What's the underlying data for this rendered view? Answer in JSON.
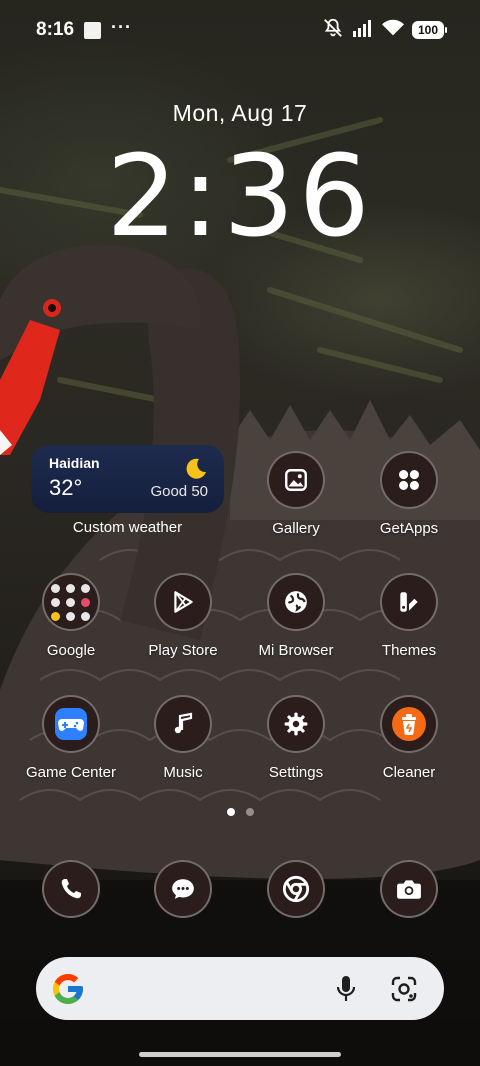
{
  "status_bar": {
    "time": "8:16",
    "more": "···",
    "battery": "100"
  },
  "lock_clock": {
    "date": "Mon, Aug 17",
    "time": "2:36"
  },
  "weather_widget": {
    "city": "Haidian",
    "temperature": "32°",
    "air_quality": "Good 50",
    "label": "Custom weather"
  },
  "apps": {
    "gallery": "Gallery",
    "getapps": "GetApps",
    "google": "Google",
    "play_store": "Play Store",
    "mi_browser": "Mi Browser",
    "themes": "Themes",
    "game_center": "Game Center",
    "music": "Music",
    "settings": "Settings",
    "cleaner": "Cleaner"
  },
  "dock": {
    "phone_icon": "phone-icon",
    "messages_icon": "chat-icon",
    "chrome_icon": "chrome-icon",
    "camera_icon": "camera-icon"
  },
  "page_indicator": {
    "pages": 2,
    "active": 1
  },
  "colors": {
    "cleaner": "#f56a14",
    "game_center": "#2f80ff",
    "weather_bg": "#1b2749",
    "beak": "#e0271b"
  }
}
